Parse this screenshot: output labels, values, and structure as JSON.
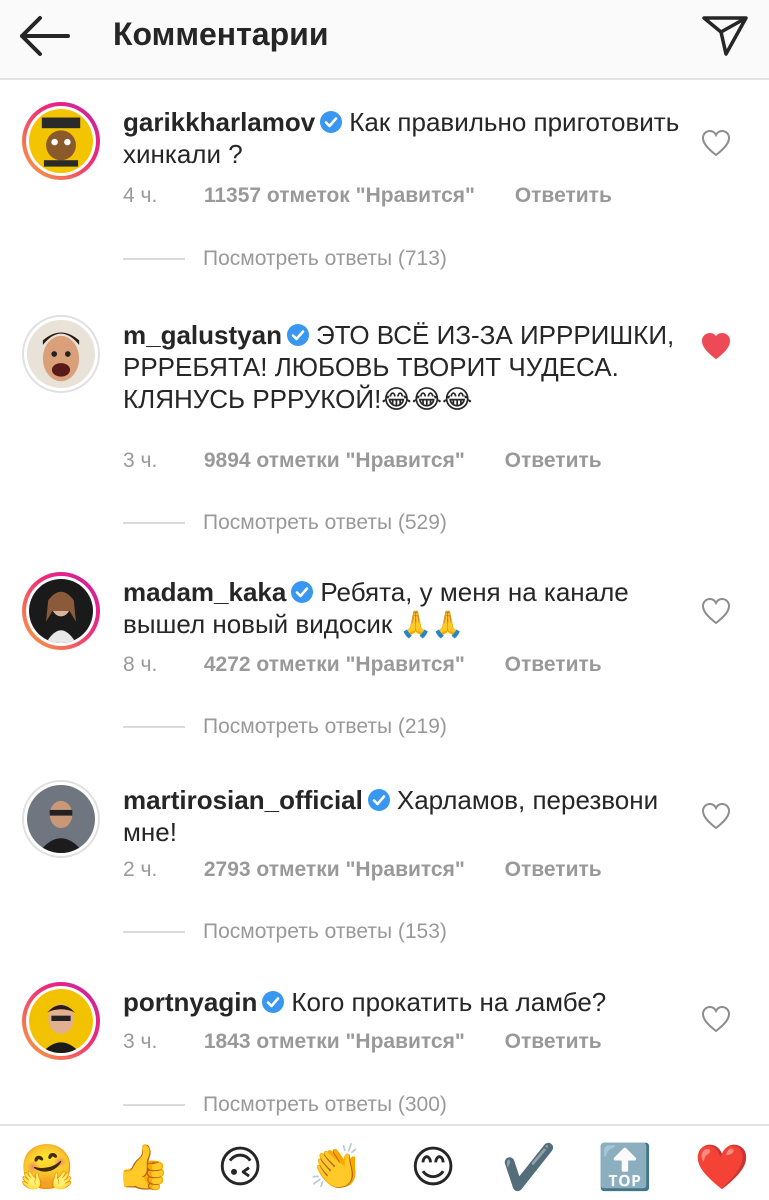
{
  "header": {
    "title": "Комментарии",
    "back_icon": "arrow-left-icon",
    "send_icon": "paper-plane-icon"
  },
  "comments": [
    {
      "username": "garikkharlamov",
      "verified": true,
      "text": "Как правильно приготовить хинкали ?",
      "time": "4 ч.",
      "likes": "11357 отметок \"Нравится\"",
      "reply": "Ответить",
      "view_replies": "Посмотреть ответы (713)",
      "liked": false
    },
    {
      "username": "m_galustyan",
      "verified": true,
      "text": "ЭТО ВСЁ ИЗ-ЗА ИРРРИШКИ, РРРЕБЯТА! ЛЮБОВЬ ТВОРИТ ЧУДЕСА. КЛЯНУСЬ РРРУКОЙ!😂😂😂",
      "time": "3 ч.",
      "likes": "9894 отметки \"Нравится\"",
      "reply": "Ответить",
      "view_replies": "Посмотреть ответы (529)",
      "liked": true
    },
    {
      "username": "madam_kaka",
      "verified": true,
      "text": "Ребята, у меня на канале вышел новый видосик 🙏🙏",
      "time": "8 ч.",
      "likes": "4272 отметки \"Нравится\"",
      "reply": "Ответить",
      "view_replies": "Посмотреть ответы (219)",
      "liked": false
    },
    {
      "username": "martirosian_official",
      "verified": true,
      "text": "Харламов, перезвони мне!",
      "time": "2 ч.",
      "likes": "2793 отметки \"Нравится\"",
      "reply": "Ответить",
      "view_replies": "Посмотреть ответы (153)",
      "liked": false
    },
    {
      "username": "portnyagin",
      "verified": true,
      "text": "Кого прокатить на ламбе?",
      "time": "3 ч.",
      "likes": "1843 отметки \"Нравится\"",
      "reply": "Ответить",
      "view_replies": "Посмотреть ответы (300)",
      "liked": false
    }
  ],
  "emoji_bar": [
    "🤗",
    "👍",
    "🙃",
    "👏",
    "😊",
    "✔️",
    "🔝",
    "❤️"
  ],
  "colors": {
    "verified": "#3897f0",
    "liked": "#ed4956",
    "secondary_text": "#999999",
    "primary_text": "#262626"
  }
}
